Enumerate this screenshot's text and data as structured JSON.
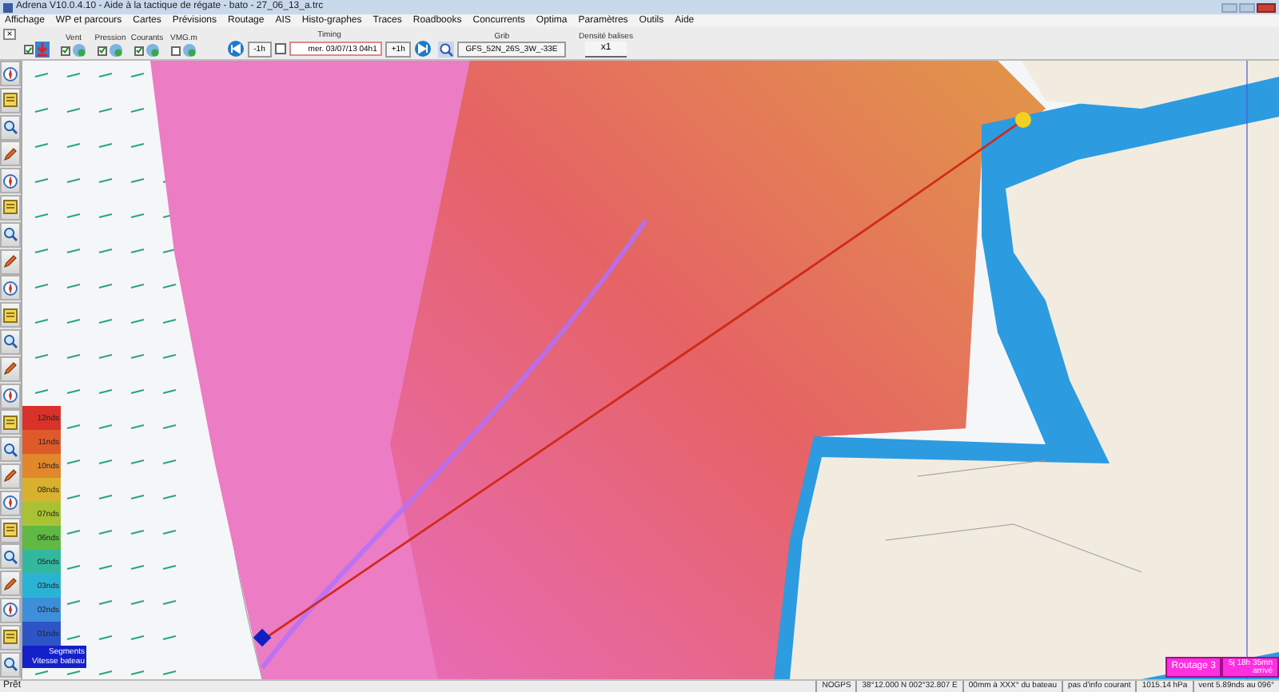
{
  "window": {
    "title": "Adrena V10.0.4.10 - Aide à la tactique de régate - bato - 27_06_13_a.trc"
  },
  "menu": [
    "Affichage",
    "WP et parcours",
    "Cartes",
    "Prévisions",
    "Routage",
    "AIS",
    "Histo-graphes",
    "Traces",
    "Roadbooks",
    "Concurrents",
    "Optima",
    "Paramètres",
    "Outils",
    "Aide"
  ],
  "toolbar": {
    "close": "×",
    "layers": [
      {
        "checked": true
      },
      {
        "label": "Vent",
        "checked": true
      },
      {
        "label": "Pression",
        "checked": true
      },
      {
        "label": "Courants",
        "checked": true
      },
      {
        "label": "VMG.m",
        "checked": false
      }
    ],
    "timing": {
      "label": "Timing",
      "back": "-1h",
      "datetime": "mer. 03/07/13 04h1",
      "forward": "+1h"
    },
    "grib": {
      "label": "Grib",
      "file": "GFS_52N_26S_3W_-33E"
    },
    "density": {
      "label": "Densité balises",
      "value": "x1"
    }
  },
  "legend": {
    "levels": [
      {
        "label": "12nds",
        "color": "#d8322a"
      },
      {
        "label": "11nds",
        "color": "#de5a2a"
      },
      {
        "label": "10nds",
        "color": "#e2872c"
      },
      {
        "label": "08nds",
        "color": "#d9b12e"
      },
      {
        "label": "07nds",
        "color": "#a9c234"
      },
      {
        "label": "06nds",
        "color": "#5fb943"
      },
      {
        "label": "05nds",
        "color": "#33b8a0"
      },
      {
        "label": "03nds",
        "color": "#2bb3d6"
      },
      {
        "label": "02nds",
        "color": "#3d8fd9"
      },
      {
        "label": "01nds",
        "color": "#2d55c8"
      }
    ],
    "footer": [
      "Segments",
      "Vitesse bateau"
    ]
  },
  "routing": {
    "name": "Routage 3",
    "eta": "5j 18h 35mn",
    "status": "arrivé"
  },
  "status_bar": {
    "message": "Prêt",
    "fields": [
      "NOGPS",
      "38°12.000 N 002°32.807 E",
      "00mm à XXX° du bateau",
      "pas d'info courant",
      "1015.14 hPa",
      "vent 5.89nds au 096°"
    ]
  }
}
